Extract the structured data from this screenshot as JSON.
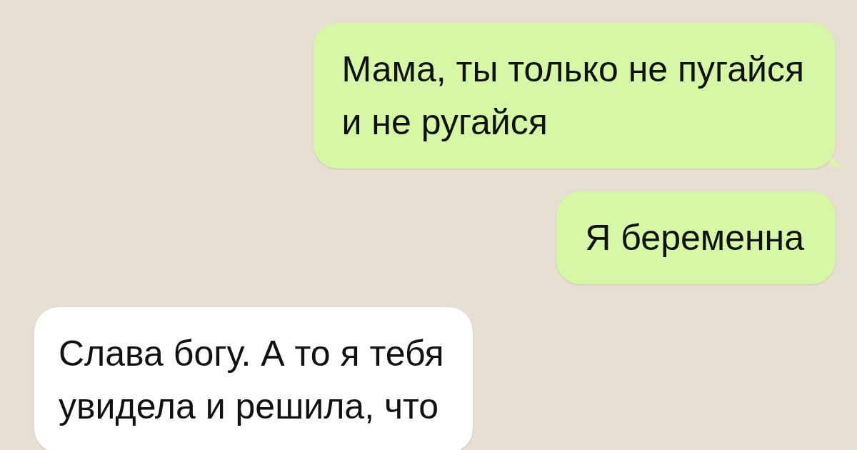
{
  "messages": [
    {
      "kind": "outgoing",
      "text": "Мама, ты только не пугайся\nи не ругайся"
    },
    {
      "kind": "outgoing",
      "text": "Я беременна"
    },
    {
      "kind": "incoming",
      "text": "Слава богу. А то я тебя\nувидела и решила, что"
    }
  ]
}
